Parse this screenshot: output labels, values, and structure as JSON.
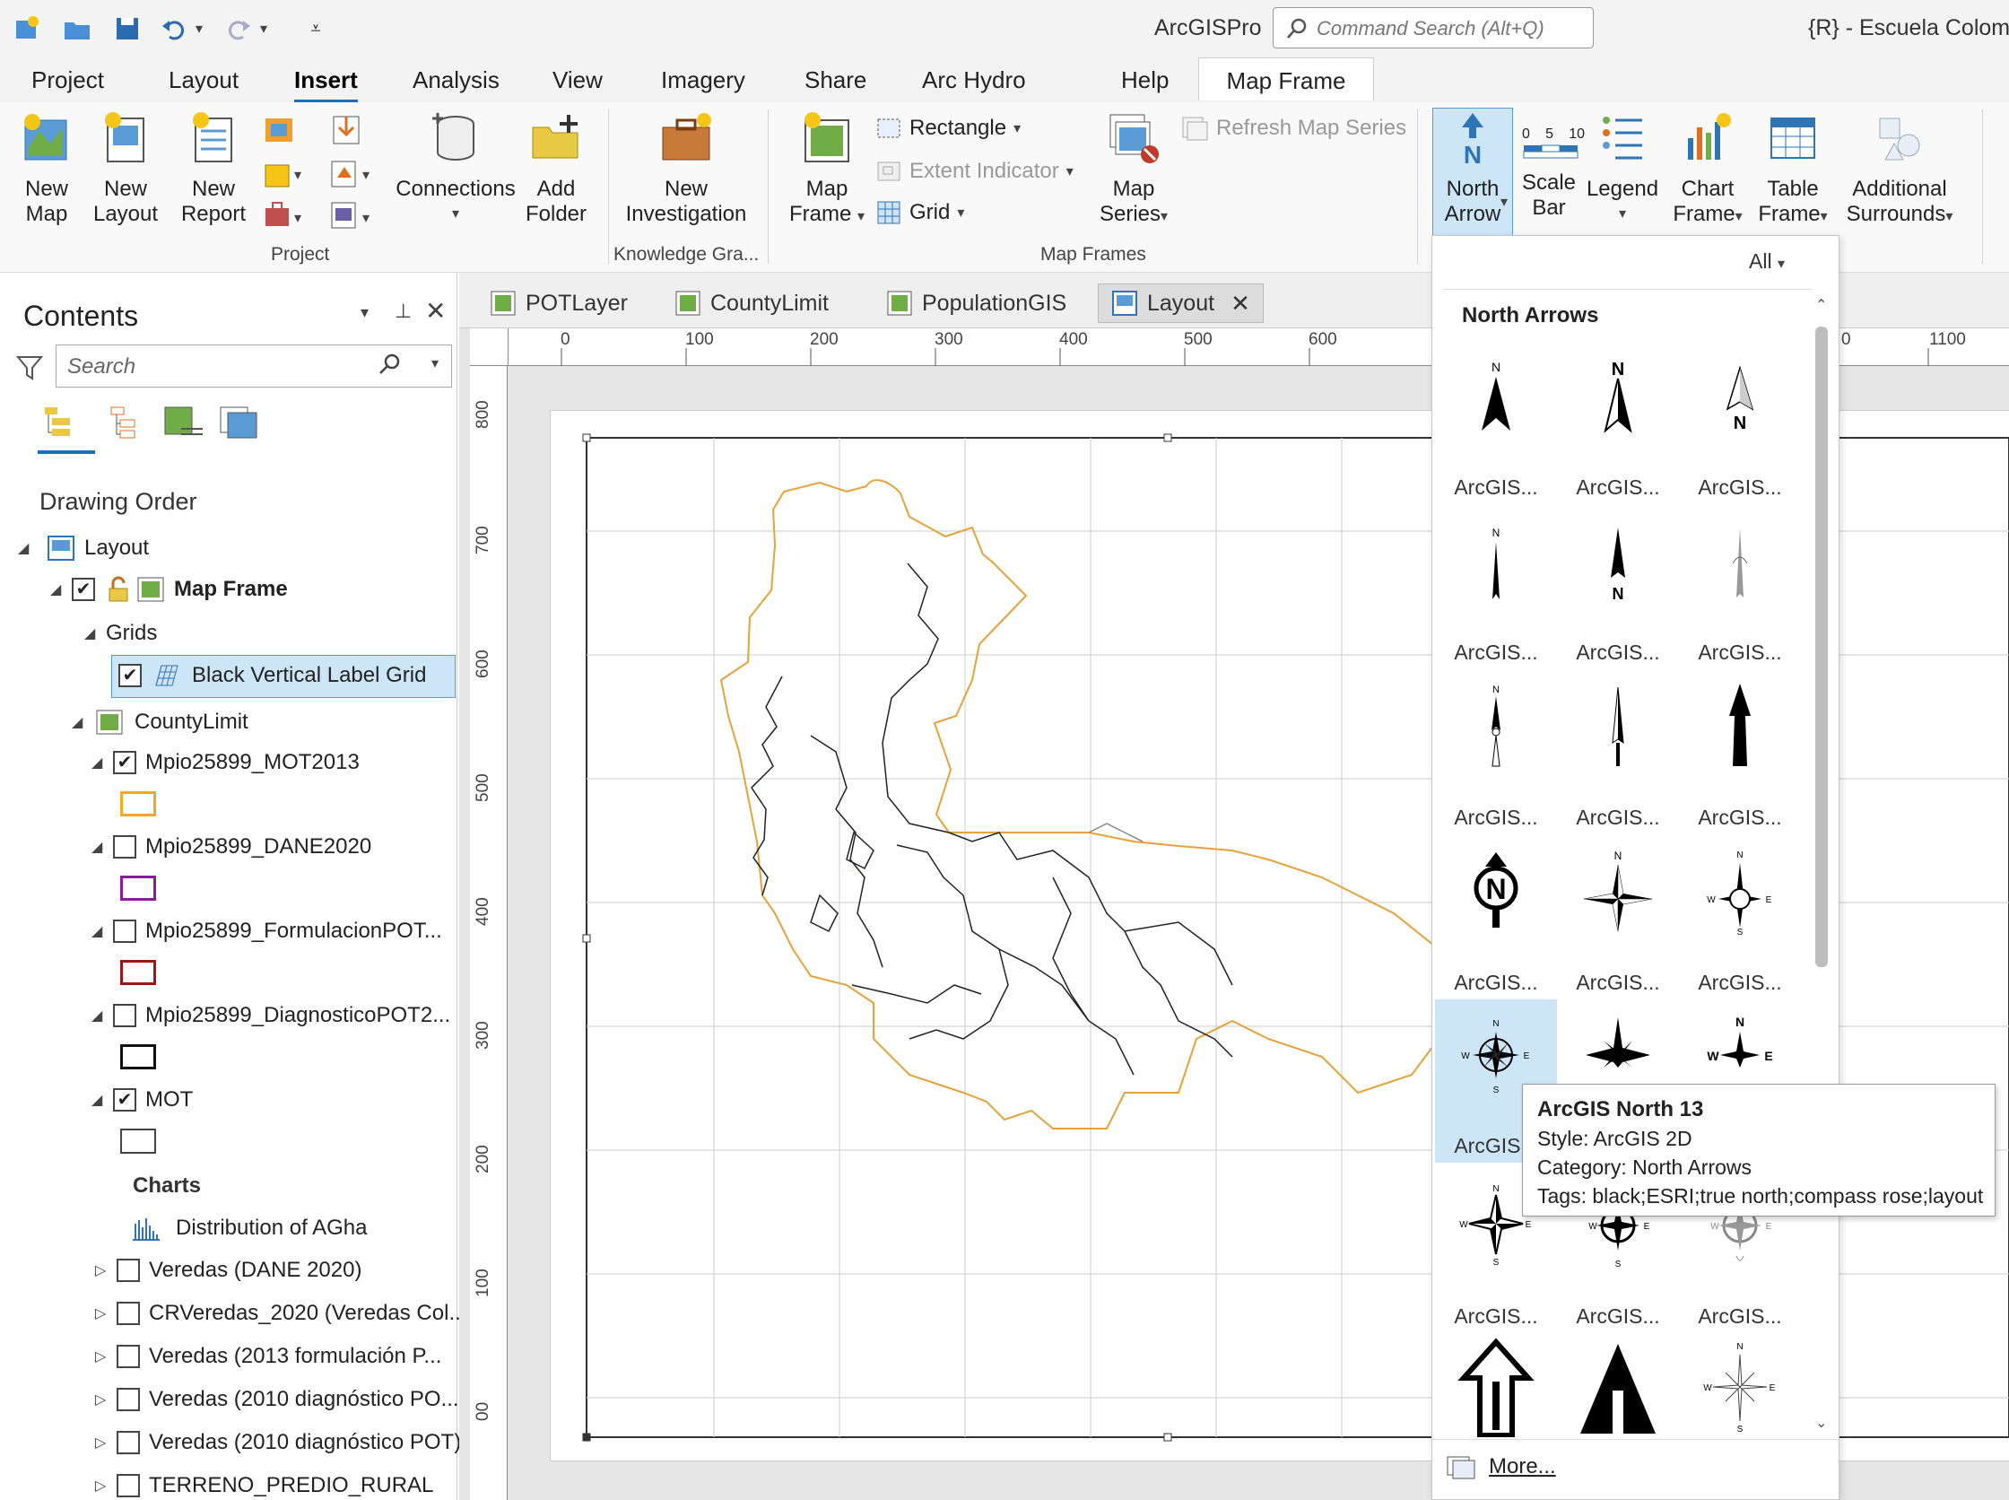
{
  "app": {
    "title": "ArcGISPro",
    "project_title": "{R} - Escuela Colomb"
  },
  "command_search": {
    "placeholder": "Command Search (Alt+Q)"
  },
  "ribbon_tabs": [
    {
      "label": "Project"
    },
    {
      "label": "Layout"
    },
    {
      "label": "Insert",
      "active": true
    },
    {
      "label": "Analysis"
    },
    {
      "label": "View"
    },
    {
      "label": "Imagery"
    },
    {
      "label": "Share"
    },
    {
      "label": "Arc Hydro"
    },
    {
      "label": "Help"
    },
    {
      "label": "Map Frame",
      "contextual": true
    }
  ],
  "ribbon": {
    "project": {
      "group_label": "Project",
      "new_map": "New Map",
      "new_layout": "New Layout",
      "new_report": "New Report",
      "connections": "Connections",
      "add_folder": "Add Folder"
    },
    "knowledge": {
      "group_label": "Knowledge Gra...",
      "new_investigation": "New Investigation"
    },
    "map_frames": {
      "group_label": "Map Frames",
      "map_frame": "Map Frame",
      "rectangle": "Rectangle",
      "extent_indicator": "Extent Indicator",
      "grid": "Grid",
      "map_series": "Map Series",
      "refresh_map_series": "Refresh Map Series"
    },
    "surrounds": {
      "north_arrow": "North Arrow",
      "scale_bar": "Scale Bar",
      "legend": "Legend",
      "chart_frame": "Chart Frame",
      "table_frame": "Table Frame",
      "additional_surrounds": "Additional Surrounds",
      "scale_bar_ticks": [
        "0",
        "5",
        "10"
      ]
    }
  },
  "contents": {
    "title": "Contents",
    "search_placeholder": "Search",
    "section": "Drawing Order",
    "layout": "Layout",
    "map_frame": "Map Frame",
    "grids": "Grids",
    "grid_item": "Black Vertical Label Grid",
    "county_limit": "CountyLimit",
    "layers": [
      {
        "name": "Mpio25899_MOT2013",
        "checked": true,
        "color": "#f5a623"
      },
      {
        "name": "Mpio25899_DANE2020",
        "checked": false,
        "color": "#8b1a9e"
      },
      {
        "name": "Mpio25899_FormulacionPOT...",
        "checked": false,
        "color": "#a31515"
      },
      {
        "name": "Mpio25899_DiagnosticoPOT2...",
        "checked": false,
        "color": "#111111"
      },
      {
        "name": "MOT",
        "checked": true,
        "color": "#444444"
      }
    ],
    "charts_label": "Charts",
    "chart_item": "Distribution of AGha",
    "other_layers": [
      "Veredas (DANE 2020)",
      "CRVeredas_2020 (Veredas Col...",
      "Veredas (2013 formulación P...",
      "Veredas (2010 diagnóstico PO...",
      "Veredas (2010 diagnóstico POT)",
      "TERRENO_PREDIO_RURAL"
    ]
  },
  "view_tabs": [
    {
      "label": "POTLayer"
    },
    {
      "label": "CountyLimit"
    },
    {
      "label": "PopulationGIS"
    },
    {
      "label": "Layout",
      "active": true
    }
  ],
  "rulers": {
    "horizontal": [
      "0",
      "100",
      "200",
      "300",
      "400",
      "500",
      "600",
      "0",
      "1100"
    ],
    "vertical": [
      "800",
      "700",
      "600",
      "500",
      "400",
      "300",
      "200",
      "100",
      "00"
    ]
  },
  "gallery": {
    "filter": "All",
    "header": "North Arrows",
    "item_label": "ArcGIS...",
    "more": "More..."
  },
  "tooltip": {
    "title": "ArcGIS North 13",
    "style": "Style: ArcGIS 2D",
    "category": "Category: North Arrows",
    "tags": "Tags: black;ESRI;true north;compass rose;layout"
  },
  "colors": {
    "accent": "#1d6fb8",
    "county_outline": "#e8a23a",
    "selected_bg": "#cde6f7"
  }
}
